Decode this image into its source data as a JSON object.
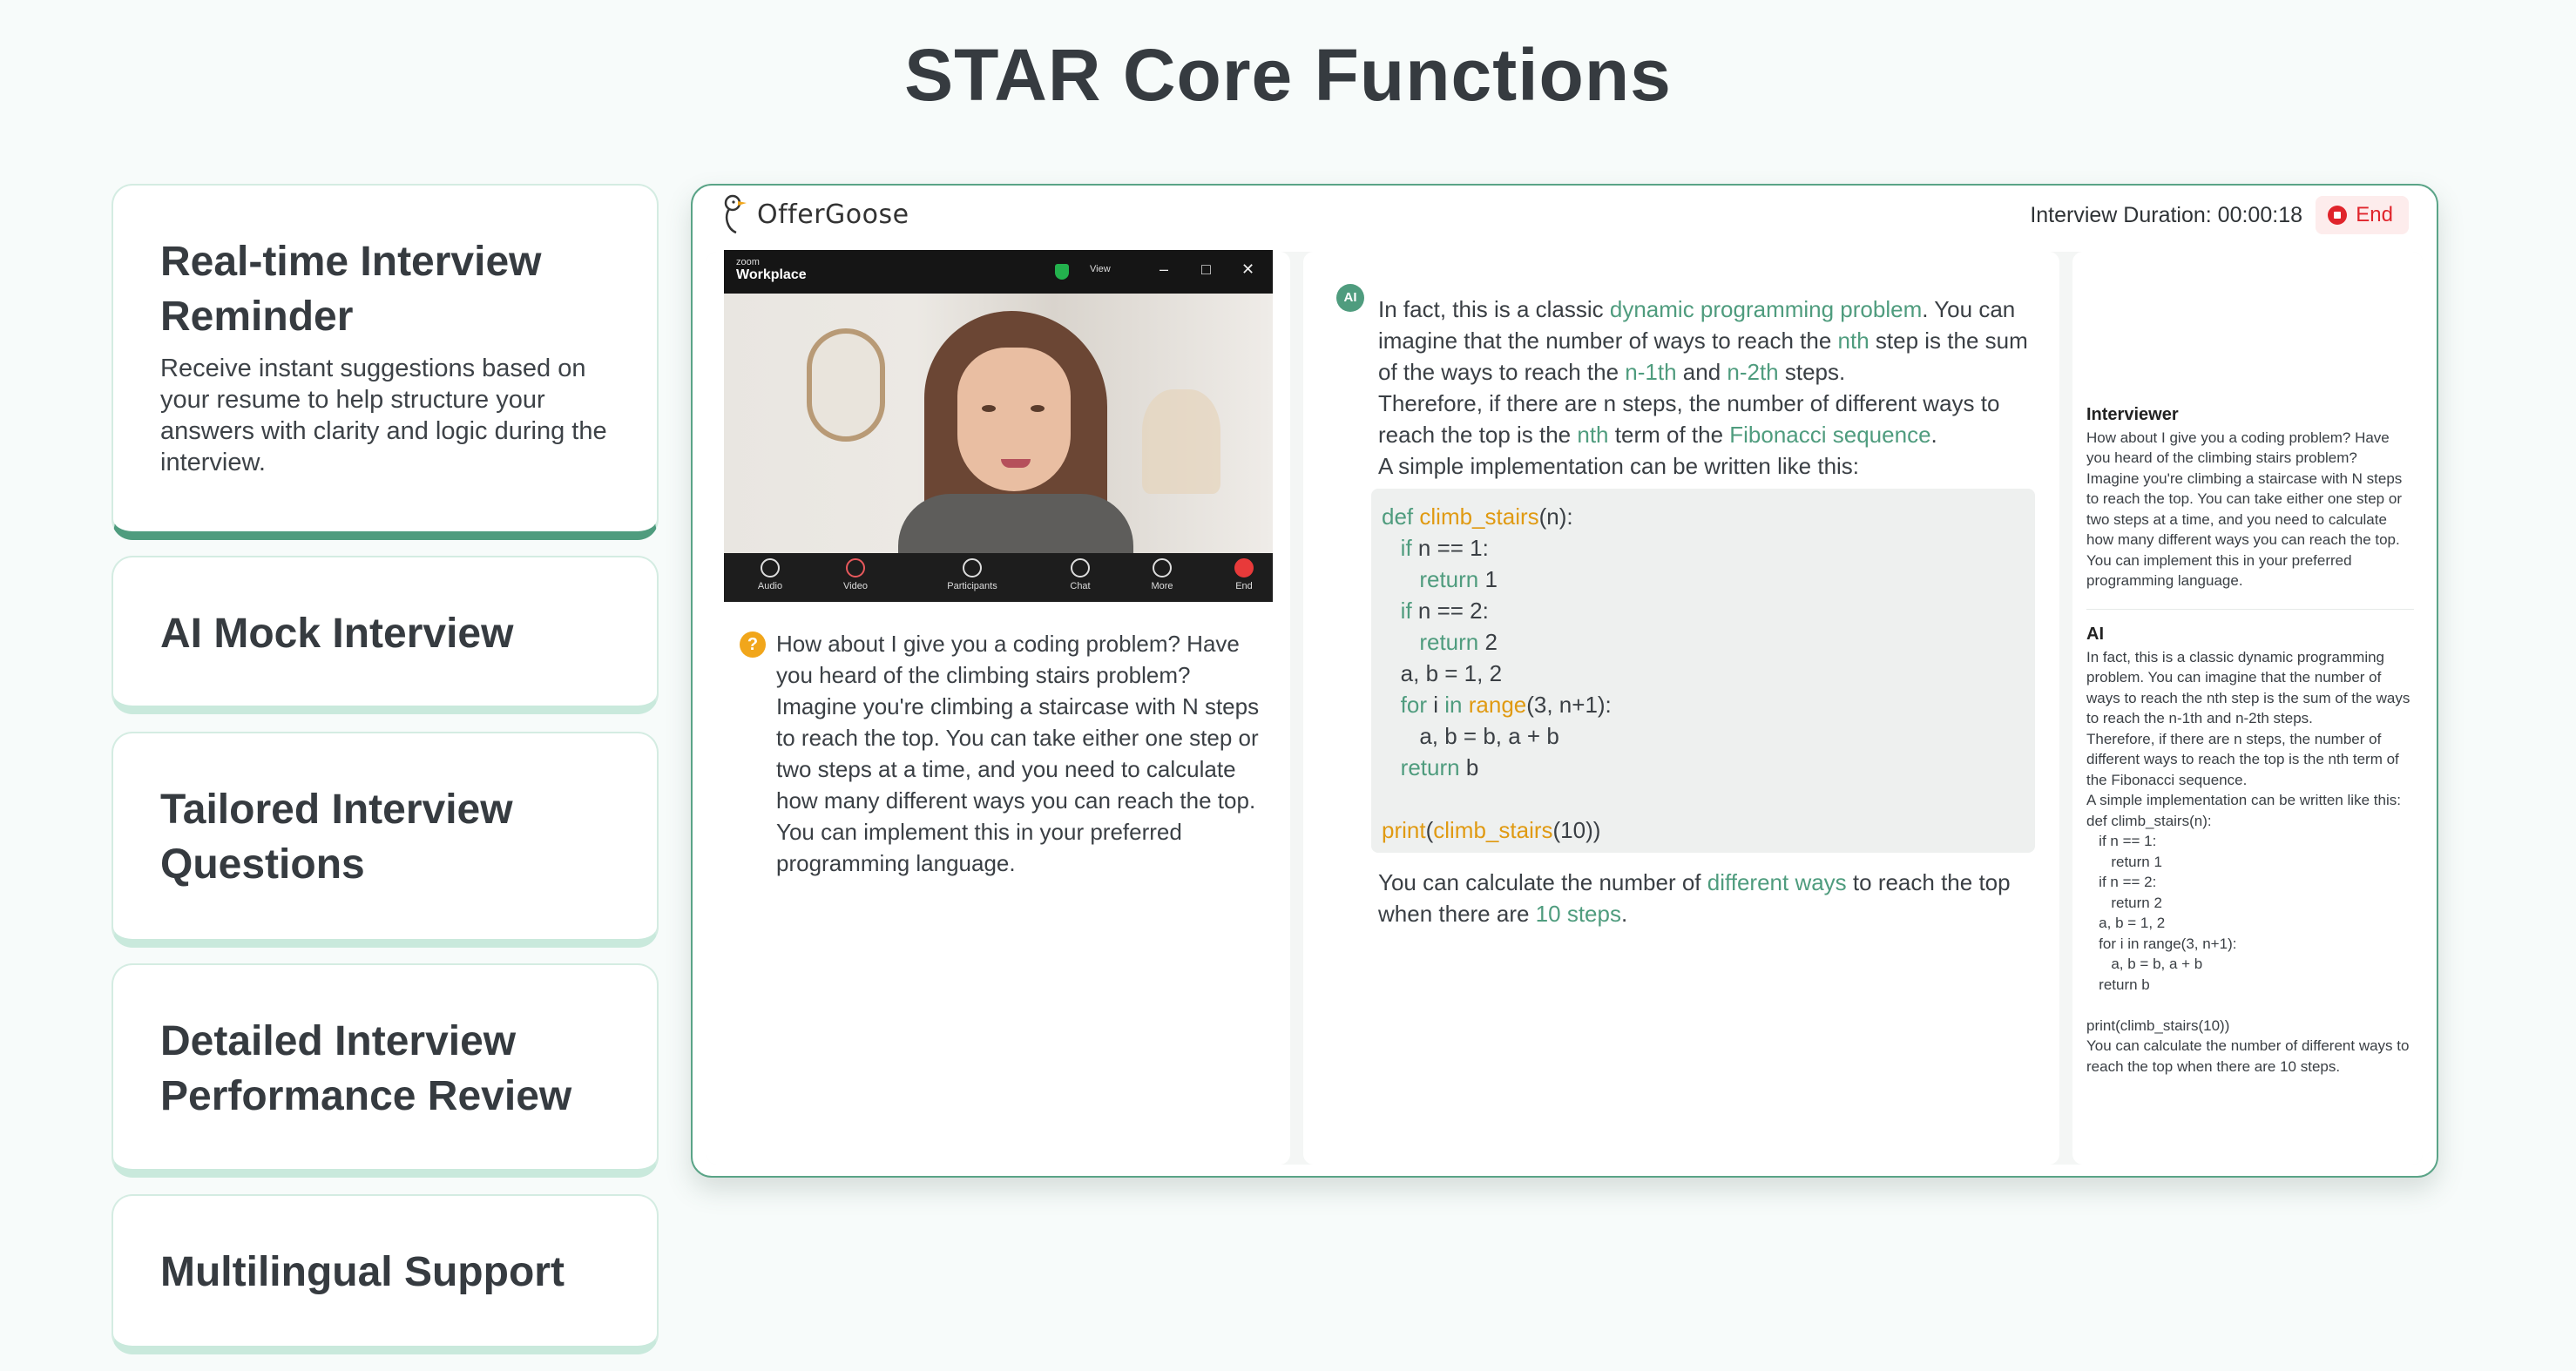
{
  "page_title": "STAR Core Functions",
  "features": [
    {
      "title": "Real-time Interview Reminder",
      "desc": "Receive instant suggestions based on your resume to help structure your answers with clarity and logic during the interview."
    },
    {
      "title": "AI Mock Interview"
    },
    {
      "title": "Tailored Interview Questions"
    },
    {
      "title": "Detailed Interview Performance Review"
    },
    {
      "title": "Multilingual Support"
    }
  ],
  "app": {
    "logo": "OfferGoose",
    "duration": "Interview Duration: 00:00:18",
    "end_label": "End",
    "zoom": {
      "brand_small": "zoom",
      "brand": "Workplace",
      "view": "View",
      "toolbar": [
        "Audio",
        "Video",
        "Participants",
        "Chat",
        "More",
        "End"
      ]
    },
    "question": "How about I give you a coding problem? Have you heard of the climbing stairs problem? Imagine you're climbing a staircase with N steps to reach the top. You can take either one step or two steps at a time, and you need to calculate how many different ways you can reach the top. You can implement this in your preferred programming language.",
    "ai_badge": "AI",
    "question_icon": "?",
    "answer": {
      "p1_a": "In fact, this is a classic ",
      "p1_hl1": "dynamic programming problem",
      "p1_b": ". You can imagine that the number of ways to reach the ",
      "p1_hl2": "nth",
      "p1_c": " step is the sum of the ways to reach the ",
      "p1_hl3": "n-1th",
      "p1_d": " and ",
      "p1_hl4": "n-2th",
      "p1_e": " steps.",
      "p2_a": "Therefore, if there are n steps, the number of different ways to reach the top is the ",
      "p2_hl1": "nth",
      "p2_b": " term of the ",
      "p2_hl2": "Fibonacci sequence",
      "p2_c": ".",
      "p3": "A simple implementation can be written like this:",
      "tail_a": "You can calculate the number of ",
      "tail_hl1": "different ways",
      "tail_b": " to reach the top when there are ",
      "tail_hl2": "10 steps",
      "tail_c": "."
    },
    "code": {
      "def": "def",
      "fn_name": "climb_stairs",
      "sig_rest": "(n):",
      "if1": "if",
      "cond1": " n == 1:",
      "ret": "return",
      "ret1": " 1",
      "if2": "if",
      "cond2": " n == 2:",
      "ret2": " 2",
      "assign": "a, b = 1, 2",
      "for": "for",
      "for_i": " i ",
      "in": "in",
      "range": "range",
      "range_args": "(3, n+1):",
      "update": "a, b = b, a + b",
      "ret_b": " b",
      "print": "print",
      "call_open": "(",
      "call_fn": "climb_stairs",
      "call_args": "(10))"
    },
    "transcript": {
      "interviewer_label": "Interviewer",
      "interviewer_text": "How about I give you a coding problem? Have you heard of the climbing stairs problem? Imagine you're climbing a staircase with N steps to reach the top. You can take either one step or two steps at a time, and you need to calculate how many different ways you can reach the top. You can implement this in your preferred programming language.",
      "ai_label": "AI",
      "ai_text": "In fact, this is a classic dynamic programming problem. You can imagine that the number of ways to reach the nth step is the sum of the ways to reach the n-1th and n-2th steps.\nTherefore, if there are n steps, the number of different ways to reach the top is the nth term of the Fibonacci sequence.\nA simple implementation can be written like this:",
      "ai_code": "def climb_stairs(n):\n   if n == 1:\n      return 1\n   if n == 2:\n      return 2\n   a, b = 1, 2\n   for i in range(3, n+1):\n      a, b = b, a + b\n   return b\n\nprint(climb_stairs(10))",
      "ai_tail": "You can calculate the number of different ways to reach the top when there are 10 steps."
    }
  },
  "colors": {
    "accent": "#4f9c7e",
    "code_fn": "#e09a12",
    "end": "#e0242b"
  }
}
